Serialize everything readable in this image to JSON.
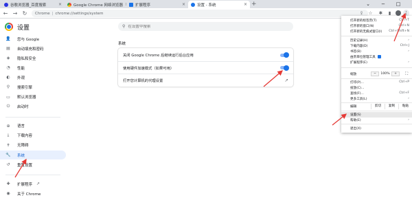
{
  "colors": {
    "accent": "#1a73e8",
    "arrow": "#e53935",
    "menu_highlight": "#e8e8e8"
  },
  "tabs": [
    {
      "title": "谷歌浏览器_百度搜索",
      "icon": "baidu-icon"
    },
    {
      "title": "Google Chrome 网络浏览器",
      "icon": "chrome-icon"
    },
    {
      "title": "扩展程序",
      "icon": "puzzle-icon"
    },
    {
      "title": "设置 - 系统",
      "icon": "gear-icon"
    }
  ],
  "toolbar": {
    "chip": "Chrome",
    "separator": "|",
    "url": "chrome://settings/system"
  },
  "settings": {
    "title": "设置",
    "search_placeholder": "在设置中搜索"
  },
  "sidebar": {
    "items": [
      {
        "label": "您与 Google",
        "icon": "person-icon"
      },
      {
        "label": "自动填充和密码",
        "icon": "autofill-icon"
      },
      {
        "label": "隐私和安全",
        "icon": "shield-icon"
      },
      {
        "label": "性能",
        "icon": "performance-icon"
      },
      {
        "label": "外观",
        "icon": "palette-icon"
      },
      {
        "label": "搜索引擎",
        "icon": "search-icon"
      },
      {
        "label": "默认浏览器",
        "icon": "browser-icon"
      },
      {
        "label": "启动时",
        "icon": "power-icon"
      }
    ],
    "items2": [
      {
        "label": "语言",
        "icon": "globe-icon"
      },
      {
        "label": "下载内容",
        "icon": "download-icon"
      },
      {
        "label": "无障碍",
        "icon": "accessibility-icon"
      },
      {
        "label": "系统",
        "icon": "wrench-icon"
      },
      {
        "label": "重置设置",
        "icon": "reset-icon"
      }
    ],
    "extensions": "扩展程序",
    "about": "关于 Chrome"
  },
  "system": {
    "section_title": "系统",
    "rows": [
      {
        "label": "关闭 Google Chrome 后继续运行后台应用",
        "enabled": true
      },
      {
        "label": "使用硬件加速模式（如果可用）",
        "enabled": true
      },
      {
        "label": "打开您计算机的代理设置"
      }
    ]
  },
  "menu": {
    "new_tab": "打开新的标签页(T)",
    "new_tab_sc": "Ctrl+T",
    "new_window": "打开新的窗口(N)",
    "new_window_sc": "Ctrl+N",
    "incognito": "打开新的无痕式窗口(I)",
    "incognito_sc": "Ctrl+Shift+N",
    "history": "历史记录(H)",
    "downloads": "下载内容(D)",
    "downloads_sc": "Ctrl+J",
    "bookmarks": "书签(B)",
    "managed": "由贵单位管理工具",
    "extensions": "扩展程序(E)",
    "zoom": "缩放",
    "zoom_minus": "−",
    "zoom_value": "100%",
    "zoom_plus": "+",
    "print": "打印(P)...",
    "print_sc": "Ctrl+P",
    "cast": "投放(C)...",
    "find": "查找(F)...",
    "find_sc": "Ctrl+F",
    "more_tools": "更多工具(L)",
    "edit": "编辑",
    "cut": "剪切",
    "copy": "复制",
    "paste": "粘贴",
    "settings": "设置(S)",
    "help": "帮助(E)",
    "exit": "退出(X)"
  }
}
